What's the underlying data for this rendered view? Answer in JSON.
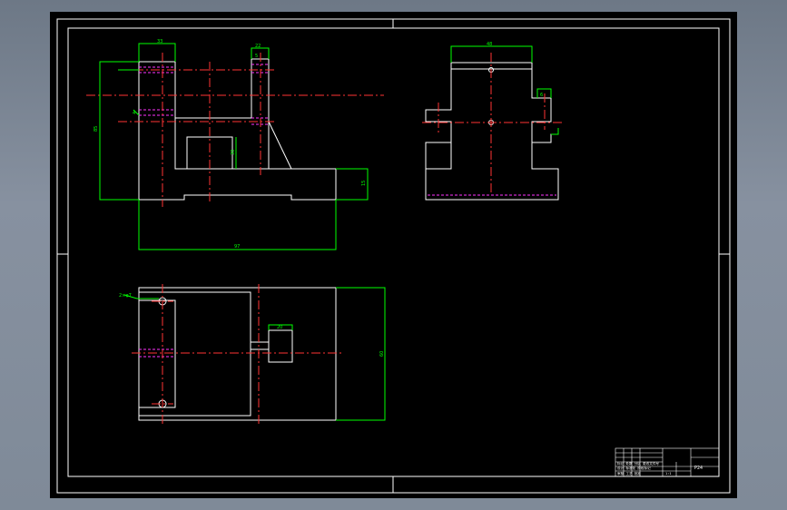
{
  "drawing": {
    "background": "#000000",
    "outline_color": "#ffffff",
    "dimension_color": "#00ff00",
    "centerline_color": "#ff3333",
    "hidden_line_color": "#ff33ff"
  },
  "front_view": {
    "dims": {
      "top_boss_width": "33",
      "rib_top_width": "22",
      "small_offset": "5",
      "hole_depth": "4",
      "overall_height": "85",
      "slot_height": "30",
      "base_height": "15",
      "overall_width": "97"
    }
  },
  "side_view": {
    "dims": {
      "top_width": "48",
      "slot_width": "6"
    }
  },
  "top_view": {
    "dims": {
      "hole_dia": "2×φ7",
      "slot_width": "20",
      "overall_depth": "60"
    }
  },
  "title_block": {
    "drawing_no": "P24",
    "rows": [
      "标记 处数 分区 更改文件号",
      "设计 标准化 阶段标记",
      "审核 工艺 批准"
    ],
    "scale": "1:1"
  }
}
